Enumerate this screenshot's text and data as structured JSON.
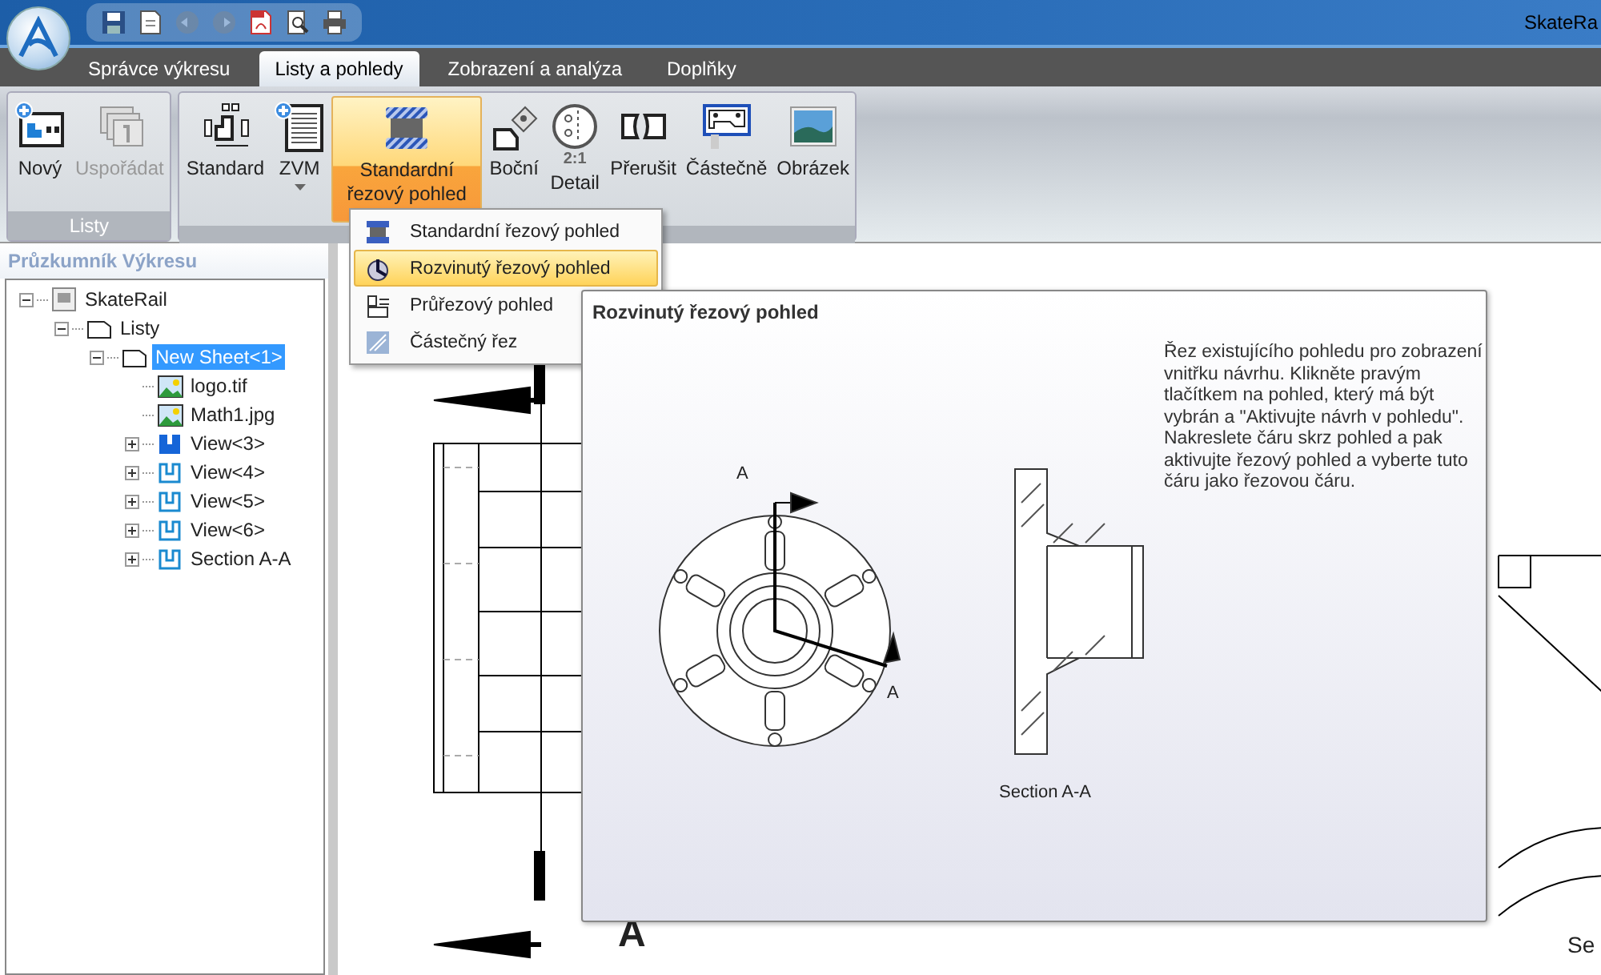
{
  "window": {
    "title": "SkateRa"
  },
  "quick_access": [
    {
      "kind": "save",
      "disabled": false
    },
    {
      "kind": "edit",
      "disabled": false
    },
    {
      "kind": "undo",
      "disabled": true
    },
    {
      "kind": "redo",
      "disabled": true
    },
    {
      "kind": "pdf",
      "disabled": false
    },
    {
      "kind": "preview",
      "disabled": false
    },
    {
      "kind": "print",
      "disabled": false
    }
  ],
  "tabs": [
    {
      "label": "Správce výkresu",
      "selected": false
    },
    {
      "label": "Listy a pohledy",
      "selected": true
    },
    {
      "label": "Zobrazení a analýza",
      "selected": false
    },
    {
      "label": "Doplňky",
      "selected": false
    }
  ],
  "ribbon_groups": [
    {
      "label": "Listy",
      "buttons": [
        {
          "kind": "new-sheet",
          "label": "Nový",
          "disabled": false,
          "pressed": false,
          "dropdown": false
        },
        {
          "kind": "arrange",
          "label": "Uspořádat",
          "disabled": true,
          "pressed": false,
          "dropdown": false
        }
      ]
    },
    {
      "buttons": [
        {
          "kind": "standard",
          "label": "Standard",
          "disabled": false,
          "pressed": false,
          "dropdown": false
        },
        {
          "kind": "zvm",
          "label": "ZVM",
          "disabled": false,
          "pressed": false,
          "dropdown": true
        },
        {
          "kind": "section",
          "label": "Standardní řezový pohled",
          "disabled": false,
          "pressed": true,
          "dropdown": true
        },
        {
          "kind": "side",
          "label": "Boční",
          "disabled": false,
          "pressed": false,
          "dropdown": false
        },
        {
          "kind": "detail",
          "label": "Detail",
          "icon_text": "2:1",
          "disabled": false,
          "pressed": false,
          "dropdown": false
        },
        {
          "kind": "break",
          "label": "Přerušit",
          "disabled": false,
          "pressed": false,
          "dropdown": false
        },
        {
          "kind": "partial",
          "label": "Částečně",
          "disabled": false,
          "pressed": false,
          "dropdown": false
        },
        {
          "kind": "picture",
          "label": "Obrázek",
          "disabled": false,
          "pressed": false,
          "dropdown": false
        }
      ]
    }
  ],
  "menu": {
    "items": [
      {
        "kind": "standard",
        "label": "Standardní řezový pohled",
        "selected": false
      },
      {
        "kind": "aligned",
        "label": "Rozvinutý řezový pohled",
        "selected": true
      },
      {
        "kind": "cross",
        "label": "Průřezový pohled",
        "selected": false
      },
      {
        "kind": "partial",
        "label": "Částečný řez",
        "selected": false
      }
    ]
  },
  "explorer": {
    "title": "Průzkumník Výkresu",
    "tree": [
      {
        "kind": "drawing",
        "label": "SkateRail",
        "expanded": true,
        "selected": false,
        "children": [
          {
            "kind": "folder",
            "label": "Listy",
            "expanded": true,
            "selected": false,
            "children": [
              {
                "kind": "sheet",
                "label": "New Sheet<1>",
                "expanded": true,
                "selected": true,
                "children": [
                  {
                    "kind": "image",
                    "label": "logo.tif",
                    "selected": false
                  },
                  {
                    "kind": "image",
                    "label": "Math1.jpg",
                    "selected": false
                  },
                  {
                    "kind": "view-active",
                    "label": "View<3>",
                    "expanded": false,
                    "selected": false
                  },
                  {
                    "kind": "view",
                    "label": "View<4>",
                    "expanded": false,
                    "selected": false
                  },
                  {
                    "kind": "view",
                    "label": "View<5>",
                    "expanded": false,
                    "selected": false
                  },
                  {
                    "kind": "view",
                    "label": "View<6>",
                    "expanded": false,
                    "selected": false
                  },
                  {
                    "kind": "view",
                    "label": "Section A-A",
                    "expanded": false,
                    "selected": false
                  }
                ]
              }
            ]
          }
        ]
      }
    ]
  },
  "canvas": {
    "labels": [
      "A",
      "Se"
    ]
  },
  "tooltip": {
    "title": "Rozvinutý řezový pohled",
    "description": "Řez existujícího pohledu pro zobrazení vnitřku návrhu. Klikněte pravým tlačítkem na pohled, který má být vybrán a \"Aktivujte návrh v pohledu\". Nakreslete čáru skrz pohled a pak aktivujte řezový pohled a vyberte tuto čáru jako řezovou čáru.",
    "labels": [
      "A",
      "A"
    ],
    "caption": "Section A-A"
  }
}
